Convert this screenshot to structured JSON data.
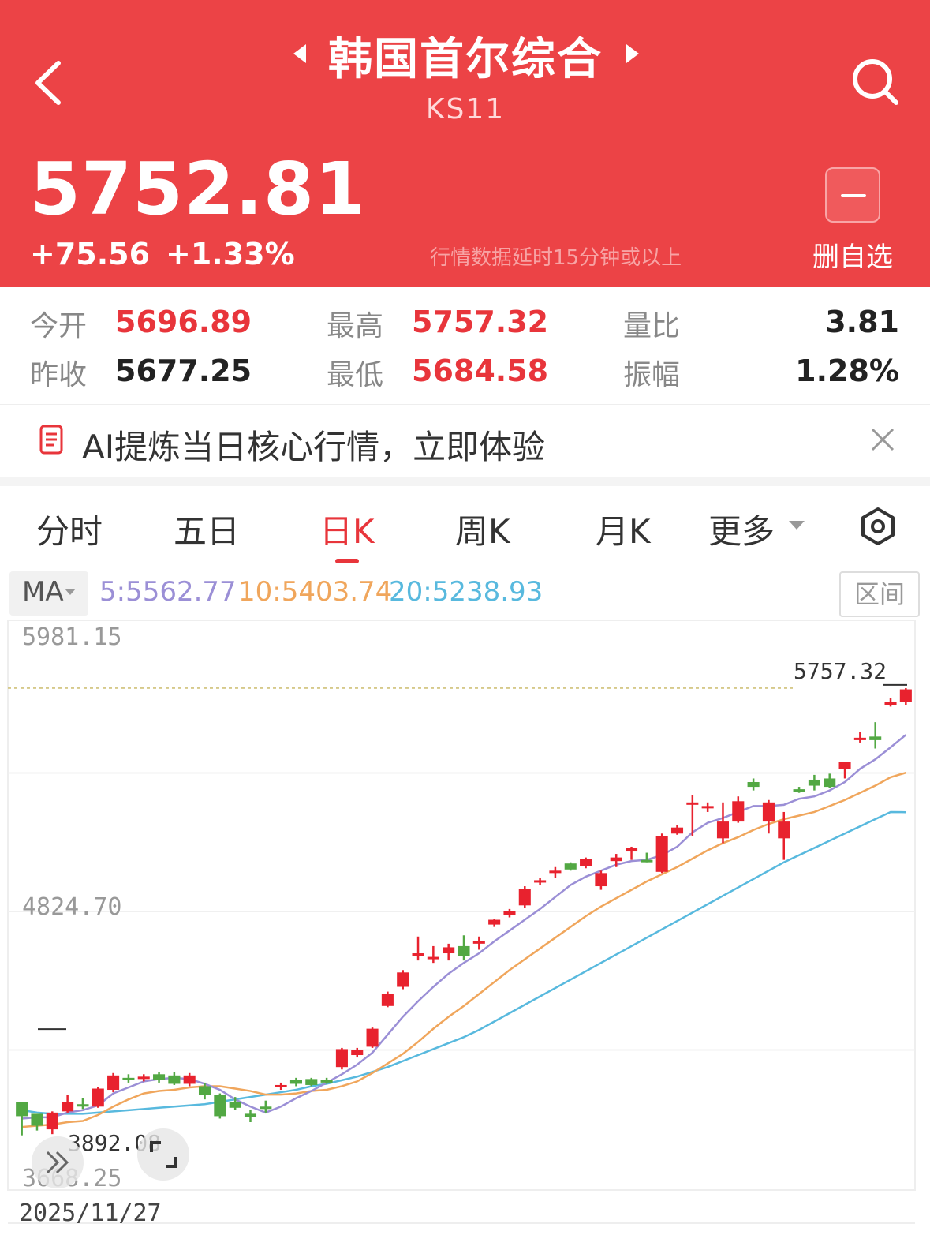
{
  "header": {
    "title": "韩国首尔综合",
    "code": "KS11",
    "price": "5752.81",
    "change": "+75.56",
    "change_pct": "+1.33%",
    "delay_note": "行情数据延时15分钟或以上",
    "remove_label": "删自选",
    "bg_color": "#ec4346"
  },
  "stats": {
    "open_label": "今开",
    "open": "5696.89",
    "high_label": "最高",
    "high": "5757.32",
    "volratio_label": "量比",
    "volratio": "3.81",
    "prevclose_label": "昨收",
    "prevclose": "5677.25",
    "low_label": "最低",
    "low": "5684.58",
    "amplitude_label": "振幅",
    "amplitude": "1.28%"
  },
  "ai_banner": {
    "text": "AI提炼当日核心行情，立即体验"
  },
  "tabs": [
    {
      "label": "分时",
      "active": false
    },
    {
      "label": "五日",
      "active": false
    },
    {
      "label": "日K",
      "active": true
    },
    {
      "label": "周K",
      "active": false
    },
    {
      "label": "月K",
      "active": false
    },
    {
      "label": "更多",
      "active": false
    }
  ],
  "ma": {
    "label": "MA",
    "ma5": "5:5562.77",
    "ma10": "10:5403.74",
    "ma20": "20:5238.93",
    "ma5_color": "#9b8fd6",
    "ma10_color": "#f0a65c",
    "ma20_color": "#58b9de",
    "range_label": "区间"
  },
  "chart_data": {
    "type": "candlestick",
    "y_top_label": "5981.15",
    "y_mid_label": "4824.70",
    "y_bottom_label": "3668.25",
    "ylim": [
      3668.25,
      5981.15
    ],
    "high_marker": "5757.32",
    "low_marker": "3892.08",
    "start_date": "2025/11/27",
    "up_color": "#e8222e",
    "down_color": "#52a843",
    "candles": [
      [
        4030,
        4020,
        3890,
        3970
      ],
      [
        3980,
        3975,
        3910,
        3930
      ],
      [
        3915,
        3990,
        3895,
        3985
      ],
      [
        3990,
        4060,
        3985,
        4030
      ],
      [
        4020,
        4045,
        4000,
        4010
      ],
      [
        4010,
        4090,
        4005,
        4085
      ],
      [
        4080,
        4150,
        4070,
        4140
      ],
      [
        4130,
        4145,
        4110,
        4125
      ],
      [
        4125,
        4145,
        4115,
        4135
      ],
      [
        4145,
        4155,
        4110,
        4120
      ],
      [
        4140,
        4155,
        4100,
        4105
      ],
      [
        4105,
        4150,
        4095,
        4140
      ],
      [
        4095,
        4110,
        4040,
        4060
      ],
      [
        4060,
        4065,
        3960,
        3970
      ],
      [
        4030,
        4050,
        3995,
        4005
      ],
      [
        3980,
        3995,
        3945,
        3965
      ],
      [
        4010,
        4035,
        3985,
        4000
      ],
      [
        4090,
        4110,
        4080,
        4100
      ],
      [
        4120,
        4130,
        4095,
        4105
      ],
      [
        4125,
        4130,
        4095,
        4100
      ],
      [
        4120,
        4130,
        4105,
        4115
      ],
      [
        4175,
        4255,
        4165,
        4250
      ],
      [
        4225,
        4255,
        4215,
        4245
      ],
      [
        4260,
        4340,
        4255,
        4335
      ],
      [
        4430,
        4490,
        4425,
        4480
      ],
      [
        4510,
        4580,
        4500,
        4570
      ],
      [
        4650,
        4720,
        4620,
        4650
      ],
      [
        4630,
        4680,
        4610,
        4635
      ],
      [
        4650,
        4690,
        4620,
        4675
      ],
      [
        4680,
        4725,
        4620,
        4640
      ],
      [
        4695,
        4720,
        4665,
        4700
      ],
      [
        4770,
        4795,
        4760,
        4790
      ],
      [
        4810,
        4835,
        4800,
        4825
      ],
      [
        4850,
        4930,
        4840,
        4920
      ],
      [
        4950,
        4965,
        4935,
        4955
      ],
      [
        4985,
        5010,
        4965,
        4995
      ],
      [
        5025,
        5030,
        4995,
        5000
      ],
      [
        5015,
        5050,
        5005,
        5045
      ],
      [
        4930,
        4995,
        4915,
        4985
      ],
      [
        5035,
        5065,
        5010,
        5050
      ],
      [
        5075,
        5095,
        5040,
        5090
      ],
      [
        5040,
        5070,
        5030,
        5035
      ],
      [
        4990,
        5150,
        4985,
        5140
      ],
      [
        5150,
        5185,
        5145,
        5175
      ],
      [
        5280,
        5310,
        5140,
        5280
      ],
      [
        5260,
        5280,
        5240,
        5265
      ],
      [
        5130,
        5280,
        5110,
        5200
      ],
      [
        5200,
        5305,
        5195,
        5285
      ],
      [
        5365,
        5380,
        5330,
        5345
      ],
      [
        5200,
        5290,
        5150,
        5280
      ],
      [
        5130,
        5240,
        5040,
        5200
      ],
      [
        5335,
        5345,
        5320,
        5330
      ],
      [
        5375,
        5395,
        5330,
        5350
      ],
      [
        5380,
        5400,
        5340,
        5345
      ],
      [
        5420,
        5445,
        5380,
        5450
      ],
      [
        5540,
        5575,
        5530,
        5550
      ],
      [
        5555,
        5615,
        5505,
        5540
      ],
      [
        5685,
        5715,
        5680,
        5700
      ],
      [
        5700,
        5757,
        5685,
        5752
      ]
    ],
    "ma5": [
      3960,
      3965,
      3965,
      3985,
      3995,
      4015,
      4065,
      4090,
      4115,
      4125,
      4130,
      4125,
      4105,
      4080,
      4040,
      4010,
      3985,
      4010,
      4045,
      4075,
      4110,
      4145,
      4185,
      4235,
      4310,
      4385,
      4450,
      4510,
      4565,
      4610,
      4650,
      4700,
      4745,
      4790,
      4835,
      4885,
      4935,
      4970,
      4995,
      5020,
      5035,
      5040,
      5060,
      5095,
      5155,
      5195,
      5215,
      5240,
      5265,
      5265,
      5270,
      5295,
      5305,
      5330,
      5365,
      5420,
      5460,
      5510,
      5562
    ],
    "ma10": [
      3925,
      3930,
      3935,
      3945,
      3950,
      3975,
      4010,
      4040,
      4065,
      4075,
      4080,
      4090,
      4095,
      4095,
      4085,
      4075,
      4060,
      4060,
      4065,
      4075,
      4080,
      4095,
      4115,
      4150,
      4190,
      4230,
      4280,
      4335,
      4385,
      4430,
      4480,
      4530,
      4580,
      4625,
      4670,
      4715,
      4760,
      4805,
      4845,
      4880,
      4915,
      4950,
      4980,
      5010,
      5045,
      5080,
      5110,
      5135,
      5165,
      5190,
      5210,
      5225,
      5240,
      5265,
      5290,
      5320,
      5350,
      5385,
      5404
    ],
    "ma20": [
      3995,
      3985,
      3980,
      3980,
      3980,
      3985,
      3990,
      3995,
      4000,
      4005,
      4010,
      4015,
      4020,
      4030,
      4040,
      4050,
      4060,
      4070,
      4080,
      4095,
      4105,
      4120,
      4135,
      4155,
      4175,
      4200,
      4225,
      4250,
      4275,
      4300,
      4330,
      4365,
      4400,
      4435,
      4470,
      4505,
      4540,
      4575,
      4610,
      4645,
      4680,
      4715,
      4750,
      4785,
      4820,
      4855,
      4890,
      4925,
      4960,
      4995,
      5030,
      5060,
      5090,
      5120,
      5150,
      5180,
      5210,
      5240,
      5239
    ]
  }
}
